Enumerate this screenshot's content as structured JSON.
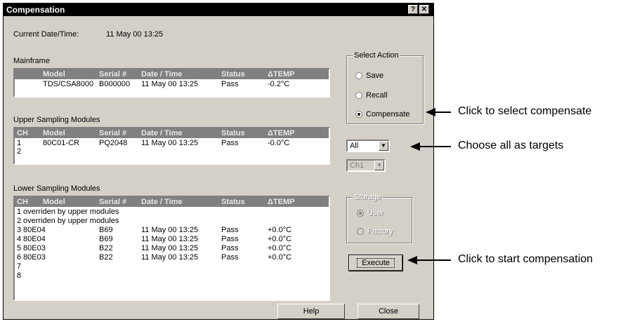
{
  "window": {
    "title": "Compensation",
    "help_btn": "?",
    "close_btn": "✕"
  },
  "current": {
    "label": "Current Date/Time:",
    "value": "11 May 00 13:25"
  },
  "mainframe": {
    "label": "Mainframe",
    "headers": [
      "Model",
      "Serial #",
      "Date / Time",
      "Status",
      "ΔTEMP"
    ],
    "row": [
      "TDS/CSA8000",
      "B000000",
      "11 May 00 13:25",
      "Pass",
      "-0.2°C"
    ]
  },
  "upper": {
    "label": "Upper Sampling Modules",
    "headers": [
      "CH",
      "Model",
      "Serial #",
      "Date / Time",
      "Status",
      "ΔTEMP"
    ],
    "rows": [
      [
        "1",
        "80C01-CR",
        "PQ2048",
        "11 May 00 13:25",
        "Pass",
        "-0.0°C"
      ],
      [
        "2",
        "",
        "",
        "",
        "",
        ""
      ]
    ]
  },
  "lower": {
    "label": "Lower Sampling Modules",
    "headers": [
      "CH",
      "Model",
      "Serial #",
      "Date / Time",
      "Status",
      "ΔTEMP"
    ],
    "rows": [
      [
        "1",
        "overriden by upper modules",
        "",
        "",
        "",
        ""
      ],
      [
        "2",
        "overriden by upper modules",
        "",
        "",
        "",
        ""
      ],
      [
        "3",
        "80E04",
        "B69",
        "11 May 00 13:25",
        "Pass",
        "+0.0°C"
      ],
      [
        "4",
        "80E04",
        "B69",
        "11 May 00 13:25",
        "Pass",
        "+0.0°C"
      ],
      [
        "5",
        "80E03",
        "B22",
        "11 May 00 13:25",
        "Pass",
        "+0.0°C"
      ],
      [
        "6",
        "80E03",
        "B22",
        "11 May 00 13:25",
        "Pass",
        "+0.0°C"
      ],
      [
        "7",
        "",
        "",
        "",
        "",
        ""
      ],
      [
        "8",
        "",
        "",
        "",
        "",
        ""
      ]
    ]
  },
  "select_action": {
    "title": "Select Action",
    "options": [
      "Save",
      "Recall",
      "Compensate"
    ],
    "selected": "Compensate"
  },
  "targets": {
    "value": "All",
    "channel": "Ch1"
  },
  "storage": {
    "title": "Storage",
    "options": [
      "User",
      "Factory"
    ],
    "selected": "User"
  },
  "buttons": {
    "execute": "Execute",
    "help": "Help",
    "close": "Close"
  },
  "callouts": {
    "compensate": "Click to select compensate",
    "targets": "Choose all as targets",
    "execute": "Click to start compensation"
  }
}
